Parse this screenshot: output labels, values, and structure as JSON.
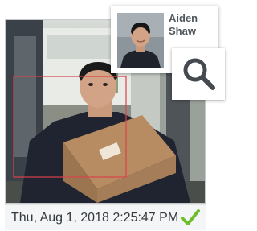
{
  "camera": {
    "timestamp": "Thu, Aug 1, 2018 2:25:47 PM",
    "status_icon": "check-icon",
    "status_color": "#6cbe2d"
  },
  "detected_person": {
    "first_name": "Aiden",
    "last_name": "Shaw"
  },
  "search": {
    "icon": "search-icon",
    "color": "#444a50"
  },
  "colors": {
    "detection_box": "#d9414a",
    "accent_check": "#6cbe2d"
  }
}
